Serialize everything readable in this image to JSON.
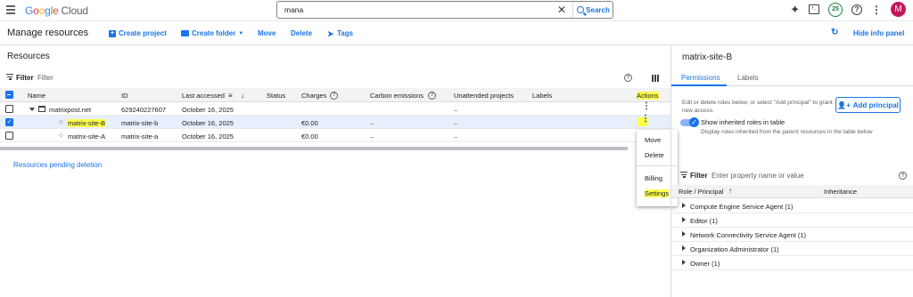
{
  "topbar": {
    "logo_google": [
      "G",
      "o",
      "o",
      "g",
      "l",
      "e"
    ],
    "logo_cloud": "Cloud",
    "search_value": "mana",
    "search_button": "Search",
    "notification_count": "25",
    "avatar_initial": "M"
  },
  "toolbar": {
    "title": "Manage resources",
    "create_project": "Create project",
    "create_folder": "Create folder",
    "move": "Move",
    "delete": "Delete",
    "tags": "Tags",
    "hide_info": "Hide info panel"
  },
  "resources": {
    "title": "Resources",
    "filter_label": "Filter",
    "filter_placeholder": "Filter",
    "columns": [
      "Name",
      "ID",
      "Last accessed",
      "Status",
      "Charges",
      "Carbon emissions",
      "Unattended projects",
      "Labels",
      "Actions"
    ],
    "rows": [
      {
        "name": "matrixpost.net",
        "id": "629240227607",
        "last_accessed": "October 16, 2025",
        "status": "",
        "charges": "",
        "carbon": "",
        "unattended": "–",
        "labels": ""
      },
      {
        "name": "matrix-site-B",
        "id": "matrix-site-b",
        "last_accessed": "October 16, 2025",
        "status": "",
        "charges": "€0.00",
        "carbon": "–",
        "unattended": "–",
        "labels": ""
      },
      {
        "name": "matrix-site-A",
        "id": "matrix-site-a",
        "last_accessed": "October 16, 2025",
        "status": "",
        "charges": "€0.00",
        "carbon": "–",
        "unattended": "–",
        "labels": ""
      }
    ],
    "pending_link": "Resources pending deletion"
  },
  "context_menu": {
    "items": [
      "Move",
      "Delete",
      "Billing",
      "Settings"
    ]
  },
  "info_panel": {
    "title": "matrix-site-B",
    "tabs": [
      "Permissions",
      "Labels"
    ],
    "description": "Edit or delete roles below, or select \"Add principal\" to grant new access.",
    "add_principal": "Add principal",
    "toggle_label": "Show inherited roles in table",
    "toggle_sub": "Display roles inherited from the parent resources in the table below",
    "filter_label": "Filter",
    "filter_placeholder": "Enter property name or value",
    "col_role": "Role / Principal",
    "col_inheritance": "Inheritance",
    "roles": [
      "Compute Engine Service Agent (1)",
      "Editor (1)",
      "Network Connectivity Service Agent (1)",
      "Organization Administrator (1)",
      "Owner (1)"
    ]
  },
  "colors": {
    "accent": "#1a73e8",
    "highlight": "#ffff4d",
    "selected_row": "#e8f0fe",
    "avatar": "#c2185b"
  }
}
